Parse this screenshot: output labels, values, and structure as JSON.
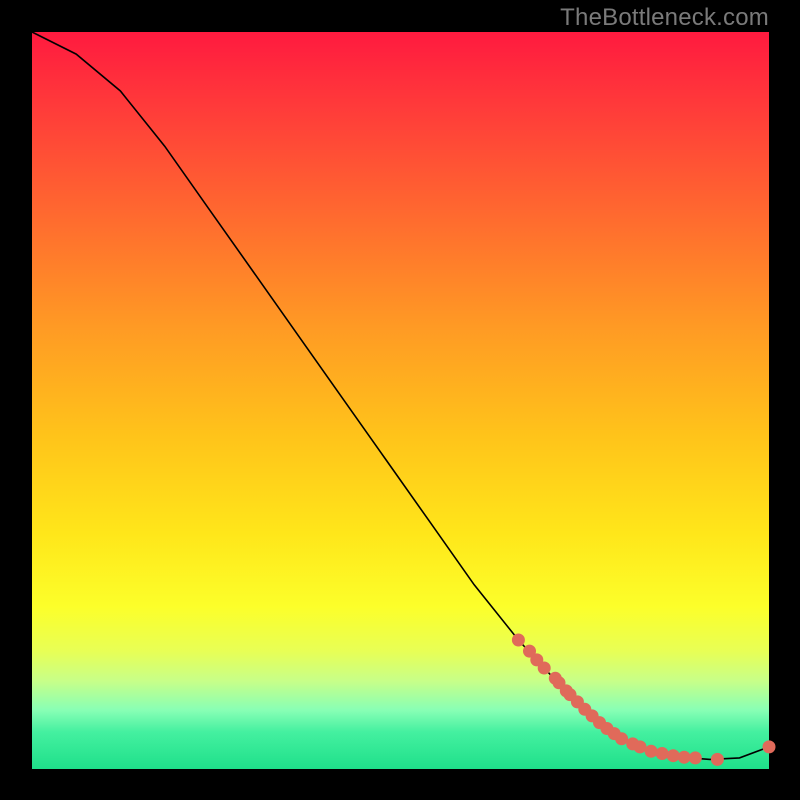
{
  "watermark": "TheBottleneck.com",
  "chart_data": {
    "type": "line",
    "title": "",
    "xlabel": "",
    "ylabel": "",
    "xlim": [
      0,
      100
    ],
    "ylim": [
      0,
      100
    ],
    "curve": {
      "x": [
        0,
        6,
        12,
        18,
        24,
        30,
        36,
        42,
        48,
        54,
        60,
        66,
        72,
        76,
        80,
        84,
        88,
        92,
        96,
        100
      ],
      "y": [
        100,
        97,
        92,
        84.5,
        76,
        67.5,
        59,
        50.5,
        42,
        33.5,
        25,
        17.5,
        11,
        7,
        4,
        2.4,
        1.6,
        1.3,
        1.5,
        3
      ]
    },
    "markers": {
      "x": [
        66,
        67.5,
        68.5,
        69.5,
        71,
        71.5,
        72.5,
        73,
        74,
        75,
        76,
        77,
        78,
        79,
        80,
        81.5,
        82.5,
        84,
        85.5,
        87,
        88.5,
        90,
        93,
        100
      ],
      "y": [
        17.5,
        16,
        14.8,
        13.7,
        12.3,
        11.7,
        10.6,
        10.1,
        9.1,
        8.1,
        7.2,
        6.3,
        5.5,
        4.8,
        4.1,
        3.4,
        3.0,
        2.4,
        2.1,
        1.8,
        1.6,
        1.5,
        1.3,
        3
      ]
    },
    "marker_color": "#e06a5a",
    "line_color": "#000000"
  }
}
